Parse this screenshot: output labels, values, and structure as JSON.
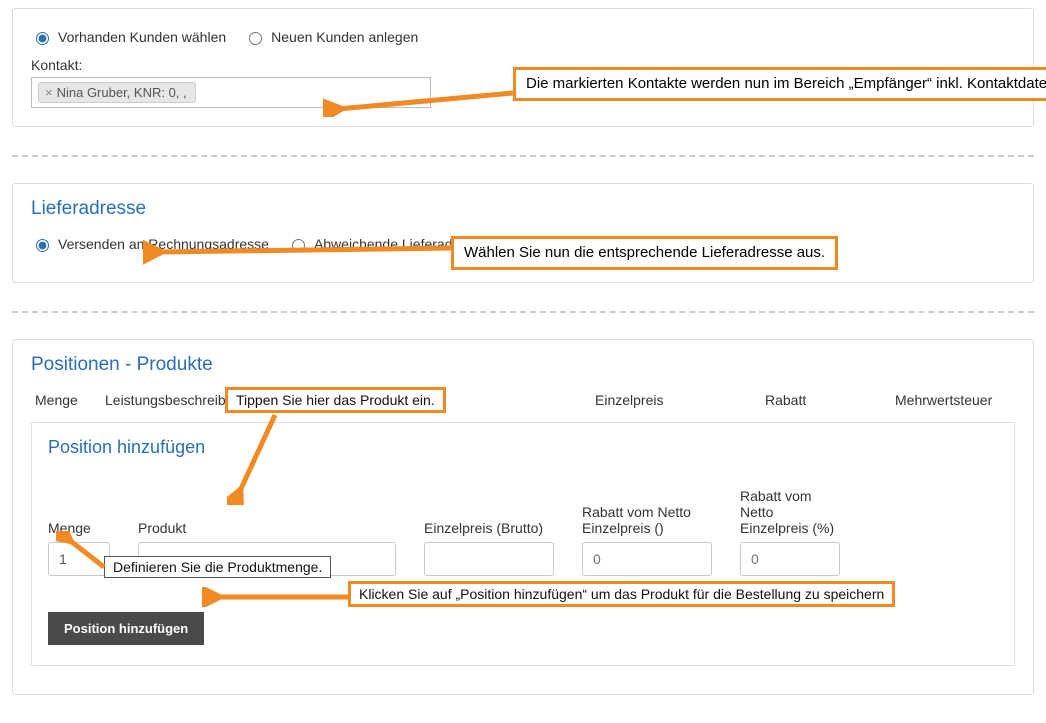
{
  "section_contact": {
    "radio_existing": "Vorhanden Kunden wählen",
    "radio_new": "Neuen Kunden anlegen",
    "label_contact": "Kontakt:",
    "tag_value": "Nina Gruber, KNR: 0, ,",
    "callout": "Die markierten Kontakte werden nun im Bereich „Empfänger“ inkl. Kontaktdaten aufgelistet."
  },
  "section_delivery": {
    "title": "Lieferadresse",
    "radio_billing": "Versenden an Rechnungsadresse",
    "radio_other": "Abweichende Lieferadresse",
    "callout": "Wählen Sie nun die entsprechende Lieferadresse aus."
  },
  "section_positions": {
    "title": "Positionen - Produkte",
    "head": {
      "menge": "Menge",
      "leistung": "Leistungsbeschreibung",
      "einzel": "Einzelpreis",
      "rabatt": "Rabatt",
      "mwst": "Mehrwertsteuer"
    },
    "add": {
      "title": "Position hinzufügen",
      "menge_label": "Menge",
      "menge_value": "1",
      "produkt_label": "Produkt",
      "ep_label": "Einzelpreis (Brutto)",
      "rabatt_label": "Rabatt vom Netto Einzelpreis ()",
      "rabatt_ph": "0",
      "rabatt2_label": "Rabatt vom Netto Einzelpreis (%)",
      "rabatt2_ph": "0",
      "button": "Position hinzufügen"
    },
    "callout_product": "Tippen Sie hier das Produkt ein.",
    "callout_menge": "Definieren Sie die Produktmenge.",
    "callout_button": "Klicken Sie auf „Position hinzufügen“ um das Produkt für die Bestellung zu speichern"
  }
}
